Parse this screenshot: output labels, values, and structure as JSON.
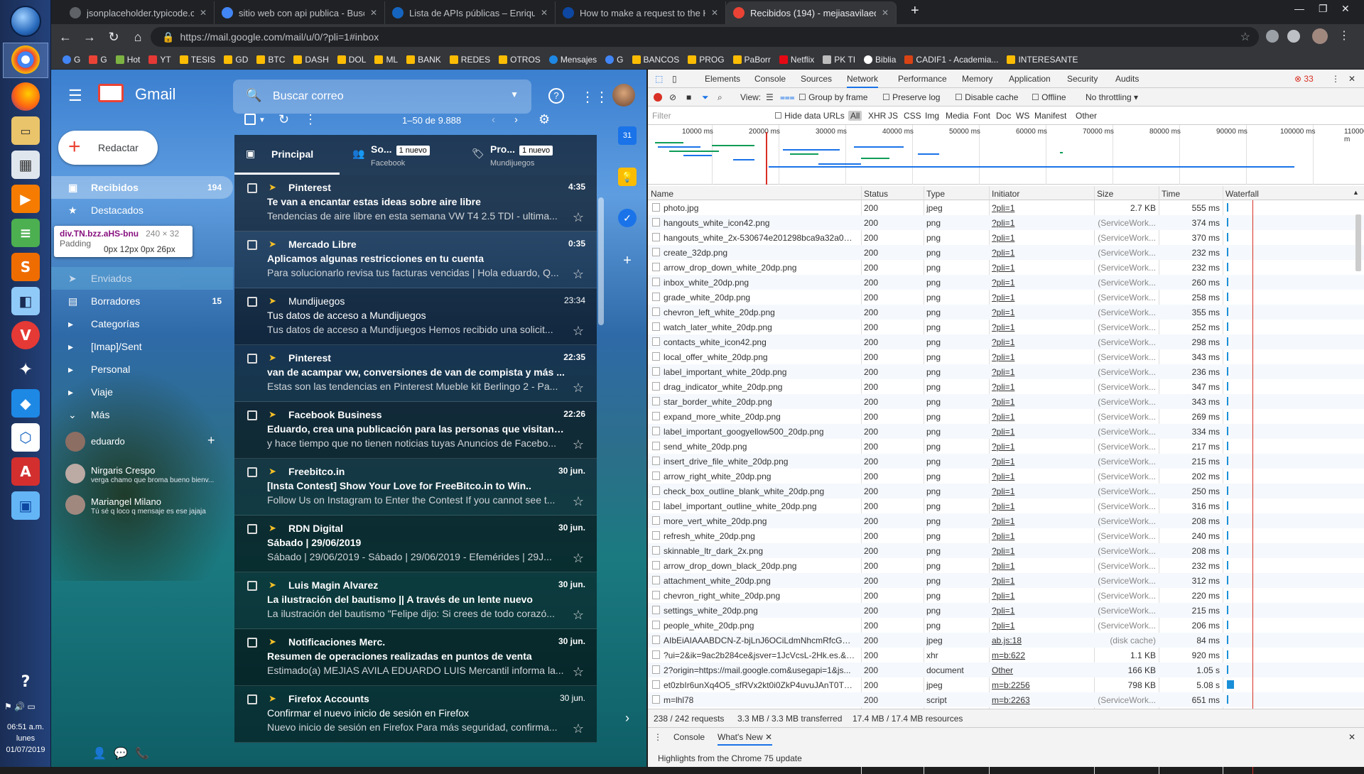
{
  "taskbar": {
    "clock_time": "06:51 a.m.",
    "clock_day": "lunes",
    "clock_date": "01/07/2019"
  },
  "browser": {
    "tabs": [
      {
        "title": "jsonplaceholder.typicode.com/us"
      },
      {
        "title": "sitio web con api publica - Busca"
      },
      {
        "title": "Lista de APIs públicas – Enrique"
      },
      {
        "title": "How to make a request to the HT"
      },
      {
        "title": "Recibidos (194) - mejiasavilaedu"
      }
    ],
    "url": "https://mail.google.com/mail/u/0/?pli=1#inbox",
    "bookmarks": [
      "G",
      "G",
      "Hot",
      "YT",
      "TESIS",
      "GD",
      "BTC",
      "DASH",
      "DOL",
      "ML",
      "BANK",
      "REDES",
      "OTROS",
      "Mensajes",
      "G",
      "BANCOS",
      "PROG",
      "PaBorr",
      "Netflix",
      "PK TI",
      "Biblia",
      "CADIF1 - Academia...",
      "INTERESANTE"
    ]
  },
  "gmail": {
    "logo_text": "Gmail",
    "search_placeholder": "Buscar correo",
    "compose_label": "Redactar",
    "pagination": "1–50 de 9.888",
    "nav": [
      {
        "label": "Recibidos",
        "count": "194"
      },
      {
        "label": "Destacados",
        "count": ""
      },
      {
        "label": "Enviados",
        "count": ""
      },
      {
        "label": "Borradores",
        "count": "15"
      },
      {
        "label": "Categorías",
        "count": ""
      },
      {
        "label": "[Imap]/Sent",
        "count": ""
      },
      {
        "label": "Personal",
        "count": ""
      },
      {
        "label": "Viaje",
        "count": ""
      },
      {
        "label": "Más",
        "count": ""
      }
    ],
    "tooltip": {
      "tag": "div.TN.bzz.aHS-bnu",
      "dims": "240 × 32",
      "padding_label": "Padding",
      "padding_value": "0px 12px 0px 26px"
    },
    "chat_user": "eduardo",
    "chats": [
      {
        "name": "Nirgaris Crespo",
        "msg": "verga chamo que broma bueno bienv..."
      },
      {
        "name": "Mariangel Milano",
        "msg": "Tú sé q loco q mensaje es ese jajaja"
      }
    ],
    "tabs": [
      {
        "label": "Principal",
        "badge": "",
        "sub": ""
      },
      {
        "label": "So...",
        "badge": "1 nuevo",
        "sub": "Facebook"
      },
      {
        "label": "Pro...",
        "badge": "1 nuevo",
        "sub": "Mundijuegos"
      }
    ],
    "emails": [
      {
        "from": "Pinterest",
        "date": "4:35",
        "subject": "Te van a encantar estas ideas sobre aire libre",
        "snippet": "Tendencias de aire libre en esta semana VW T4 2.5 TDI - ultima..."
      },
      {
        "from": "Mercado Libre",
        "date": "0:35",
        "subject": "Aplicamos algunas restricciones en tu cuenta",
        "snippet": "Para solucionarlo revisa tus facturas vencidas | Hola eduardo, Q..."
      },
      {
        "from": "Mundijuegos",
        "date": "23:34",
        "subject": "Tus datos de acceso a Mundijuegos",
        "snippet": "Tus datos de acceso a Mundijuegos Hemos recibido una solicit..."
      },
      {
        "from": "Pinterest",
        "date": "22:35",
        "subject": "van de acampar vw, conversiones de van de compista y más ...",
        "snippet": "Estas son las tendencias en Pinterest Mueble kit Berlingo 2 - Pa..."
      },
      {
        "from": "Facebook Business",
        "date": "22:26",
        "subject": "Eduardo, crea una publicación para las personas que visitan \"A...",
        "snippet": "y hace tiempo que no tienen noticias tuyas Anuncios de Facebo..."
      },
      {
        "from": "Freebitco.in",
        "date": "30 jun.",
        "subject": "[Insta Contest] Show Your Love for FreeBitco.in to Win..",
        "snippet": "Follow Us on Instagram to Enter the Contest If you cannot see t..."
      },
      {
        "from": "RDN Digital",
        "date": "30 jun.",
        "subject": "Sábado | 29/06/2019",
        "snippet": "Sábado | 29/06/2019 - Sábado | 29/06/2019 - Efemérides | 29J..."
      },
      {
        "from": "Luis Magin Alvarez",
        "date": "30 jun.",
        "subject": "La ilustración del bautismo || A través de un lente nuevo",
        "snippet": "La ilustración del bautismo \"Felipe dijo: Si crees de todo corazó..."
      },
      {
        "from": "Notificaciones Merc.",
        "date": "30 jun.",
        "subject": "Resumen de operaciones realizadas en puntos de venta",
        "snippet": "Estimado(a) MEJIAS AVILA EDUARDO LUIS Mercantil informa la..."
      },
      {
        "from": "Firefox Accounts",
        "date": "30 jun.",
        "subject": "Confirmar el nuevo inicio de sesión en Firefox",
        "snippet": "Nuevo inicio de sesión en Firefox Para más seguridad, confirma..."
      }
    ]
  },
  "devtools": {
    "tabs": [
      "Elements",
      "Console",
      "Sources",
      "Network",
      "Performance",
      "Memory",
      "Application",
      "Security",
      "Audits"
    ],
    "error_count": "33",
    "toolbar": {
      "view_label": "View:",
      "group_by_frame": "Group by frame",
      "preserve_log": "Preserve log",
      "disable_cache": "Disable cache",
      "offline": "Offline",
      "throttling": "No throttling"
    },
    "filter": {
      "placeholder": "Filter",
      "hide_data_urls": "Hide data URLs",
      "types": [
        "All",
        "XHR",
        "JS",
        "CSS",
        "Img",
        "Media",
        "Font",
        "Doc",
        "WS",
        "Manifest",
        "Other"
      ]
    },
    "overview_ticks": [
      "10000 ms",
      "20000 ms",
      "30000 ms",
      "40000 ms",
      "50000 ms",
      "60000 ms",
      "70000 ms",
      "80000 ms",
      "90000 ms",
      "100000 ms",
      "110000 m"
    ],
    "columns": [
      "Name",
      "Status",
      "Type",
      "Initiator",
      "Size",
      "Time",
      "Waterfall"
    ],
    "rows": [
      {
        "name": "photo.jpg",
        "status": "200",
        "type": "jpeg",
        "initiator": "?pli=1",
        "size": "2.7 KB",
        "time": "555 ms"
      },
      {
        "name": "hangouts_white_icon42.png",
        "status": "200",
        "type": "png",
        "initiator": "?pli=1",
        "size": "(ServiceWork...",
        "time": "374 ms"
      },
      {
        "name": "hangouts_white_2x-530674e201298bca9a32a0d0...",
        "status": "200",
        "type": "png",
        "initiator": "?pli=1",
        "size": "(ServiceWork...",
        "time": "370 ms"
      },
      {
        "name": "create_32dp.png",
        "status": "200",
        "type": "png",
        "initiator": "?pli=1",
        "size": "(ServiceWork...",
        "time": "232 ms"
      },
      {
        "name": "arrow_drop_down_white_20dp.png",
        "status": "200",
        "type": "png",
        "initiator": "?pli=1",
        "size": "(ServiceWork...",
        "time": "232 ms"
      },
      {
        "name": "inbox_white_20dp.png",
        "status": "200",
        "type": "png",
        "initiator": "?pli=1",
        "size": "(ServiceWork...",
        "time": "260 ms"
      },
      {
        "name": "grade_white_20dp.png",
        "status": "200",
        "type": "png",
        "initiator": "?pli=1",
        "size": "(ServiceWork...",
        "time": "258 ms"
      },
      {
        "name": "chevron_left_white_20dp.png",
        "status": "200",
        "type": "png",
        "initiator": "?pli=1",
        "size": "(ServiceWork...",
        "time": "355 ms"
      },
      {
        "name": "watch_later_white_20dp.png",
        "status": "200",
        "type": "png",
        "initiator": "?pli=1",
        "size": "(ServiceWork...",
        "time": "252 ms"
      },
      {
        "name": "contacts_white_icon42.png",
        "status": "200",
        "type": "png",
        "initiator": "?pli=1",
        "size": "(ServiceWork...",
        "time": "298 ms"
      },
      {
        "name": "local_offer_white_20dp.png",
        "status": "200",
        "type": "png",
        "initiator": "?pli=1",
        "size": "(ServiceWork...",
        "time": "343 ms"
      },
      {
        "name": "label_important_white_20dp.png",
        "status": "200",
        "type": "png",
        "initiator": "?pli=1",
        "size": "(ServiceWork...",
        "time": "236 ms"
      },
      {
        "name": "drag_indicator_white_20dp.png",
        "status": "200",
        "type": "png",
        "initiator": "?pli=1",
        "size": "(ServiceWork...",
        "time": "347 ms"
      },
      {
        "name": "star_border_white_20dp.png",
        "status": "200",
        "type": "png",
        "initiator": "?pli=1",
        "size": "(ServiceWork...",
        "time": "343 ms"
      },
      {
        "name": "expand_more_white_20dp.png",
        "status": "200",
        "type": "png",
        "initiator": "?pli=1",
        "size": "(ServiceWork...",
        "time": "269 ms"
      },
      {
        "name": "label_important_googyellow500_20dp.png",
        "status": "200",
        "type": "png",
        "initiator": "?pli=1",
        "size": "(ServiceWork...",
        "time": "334 ms"
      },
      {
        "name": "send_white_20dp.png",
        "status": "200",
        "type": "png",
        "initiator": "?pli=1",
        "size": "(ServiceWork...",
        "time": "217 ms"
      },
      {
        "name": "insert_drive_file_white_20dp.png",
        "status": "200",
        "type": "png",
        "initiator": "?pli=1",
        "size": "(ServiceWork...",
        "time": "215 ms"
      },
      {
        "name": "arrow_right_white_20dp.png",
        "status": "200",
        "type": "png",
        "initiator": "?pli=1",
        "size": "(ServiceWork...",
        "time": "202 ms"
      },
      {
        "name": "check_box_outline_blank_white_20dp.png",
        "status": "200",
        "type": "png",
        "initiator": "?pli=1",
        "size": "(ServiceWork...",
        "time": "250 ms"
      },
      {
        "name": "label_important_outline_white_20dp.png",
        "status": "200",
        "type": "png",
        "initiator": "?pli=1",
        "size": "(ServiceWork...",
        "time": "316 ms"
      },
      {
        "name": "more_vert_white_20dp.png",
        "status": "200",
        "type": "png",
        "initiator": "?pli=1",
        "size": "(ServiceWork...",
        "time": "208 ms"
      },
      {
        "name": "refresh_white_20dp.png",
        "status": "200",
        "type": "png",
        "initiator": "?pli=1",
        "size": "(ServiceWork...",
        "time": "240 ms"
      },
      {
        "name": "skinnable_ltr_dark_2x.png",
        "status": "200",
        "type": "png",
        "initiator": "?pli=1",
        "size": "(ServiceWork...",
        "time": "208 ms"
      },
      {
        "name": "arrow_drop_down_black_20dp.png",
        "status": "200",
        "type": "png",
        "initiator": "?pli=1",
        "size": "(ServiceWork...",
        "time": "232 ms"
      },
      {
        "name": "attachment_white_20dp.png",
        "status": "200",
        "type": "png",
        "initiator": "?pli=1",
        "size": "(ServiceWork...",
        "time": "312 ms"
      },
      {
        "name": "chevron_right_white_20dp.png",
        "status": "200",
        "type": "png",
        "initiator": "?pli=1",
        "size": "(ServiceWork...",
        "time": "220 ms"
      },
      {
        "name": "settings_white_20dp.png",
        "status": "200",
        "type": "png",
        "initiator": "?pli=1",
        "size": "(ServiceWork...",
        "time": "215 ms"
      },
      {
        "name": "people_white_20dp.png",
        "status": "200",
        "type": "png",
        "initiator": "?pli=1",
        "size": "(ServiceWork...",
        "time": "206 ms"
      },
      {
        "name": "AIbEiAIAAABDCN-Z-bjLnJ6OCiLdmNhcmRfcGhvd...",
        "status": "200",
        "type": "jpeg",
        "initiator": "ab.js:18",
        "size": "(disk cache)",
        "time": "84 ms"
      },
      {
        "name": "?ui=2&ik=9ac2b284ce&jsver=1JcVcsL-2Hk.es.&c...",
        "status": "200",
        "type": "xhr",
        "initiator": "m=b:622",
        "size": "1.1 KB",
        "time": "920 ms"
      },
      {
        "name": "2?origin=https://mail.google.com&usegapi=1&js...",
        "status": "200",
        "type": "document",
        "initiator": "Other",
        "size": "166 KB",
        "time": "1.05 s"
      },
      {
        "name": "et0zbIr6unXq4O5_sfRVx2kt0i0ZkP4uvuJAnT0TQK...",
        "status": "200",
        "type": "jpeg",
        "initiator": "m=b:2256",
        "size": "798 KB",
        "time": "5.08 s"
      },
      {
        "name": "m=lhl78",
        "status": "200",
        "type": "script",
        "initiator": "m=b:2263",
        "size": "(ServiceWork...",
        "time": "651 ms"
      }
    ],
    "status": {
      "requests": "238 / 242 requests",
      "transferred": "3.3 MB / 3.3 MB transferred",
      "resources": "17.4 MB / 17.4 MB resources"
    },
    "drawer": {
      "tabs": [
        "Console",
        "What's New"
      ],
      "message": "Highlights from the Chrome 75 update"
    }
  }
}
